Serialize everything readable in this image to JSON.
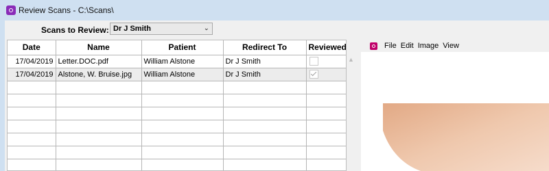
{
  "window": {
    "title": "Review Scans - C:\\Scans\\"
  },
  "filter": {
    "label": "Scans to Review:",
    "selected": "Dr J Smith"
  },
  "grid": {
    "columns": [
      "Date",
      "Name",
      "Patient",
      "Redirect To",
      "Reviewed"
    ],
    "rows": [
      {
        "date": "17/04/2019",
        "name": "Letter.DOC.pdf",
        "patient": "William Alstone",
        "redirect": "Dr J Smith",
        "reviewed": false
      },
      {
        "date": "17/04/2019",
        "name": "Alstone, W. Bruise.jpg",
        "patient": "William Alstone",
        "redirect": "Dr J Smith",
        "reviewed": true
      }
    ]
  },
  "viewer": {
    "menu": [
      "File",
      "Edit",
      "Image",
      "View"
    ]
  }
}
